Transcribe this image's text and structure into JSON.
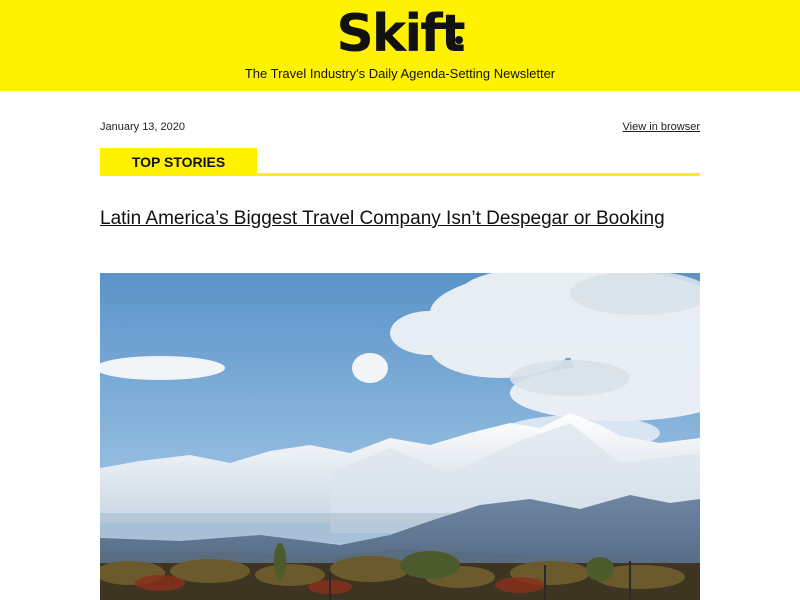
{
  "header": {
    "logo_text": "Skift",
    "tagline": "The Travel Industry's Daily Agenda-Setting Newsletter",
    "bg_color": "#fff200"
  },
  "meta": {
    "date": "January 13, 2020",
    "view_in_browser": "View in browser"
  },
  "section": {
    "label": "TOP STORIES"
  },
  "story": {
    "headline": "Latin America’s Biggest Travel Company Isn’t Despegar or Booking",
    "image_subject": "snow-capped mountains above a vineyard under a blue sky"
  }
}
